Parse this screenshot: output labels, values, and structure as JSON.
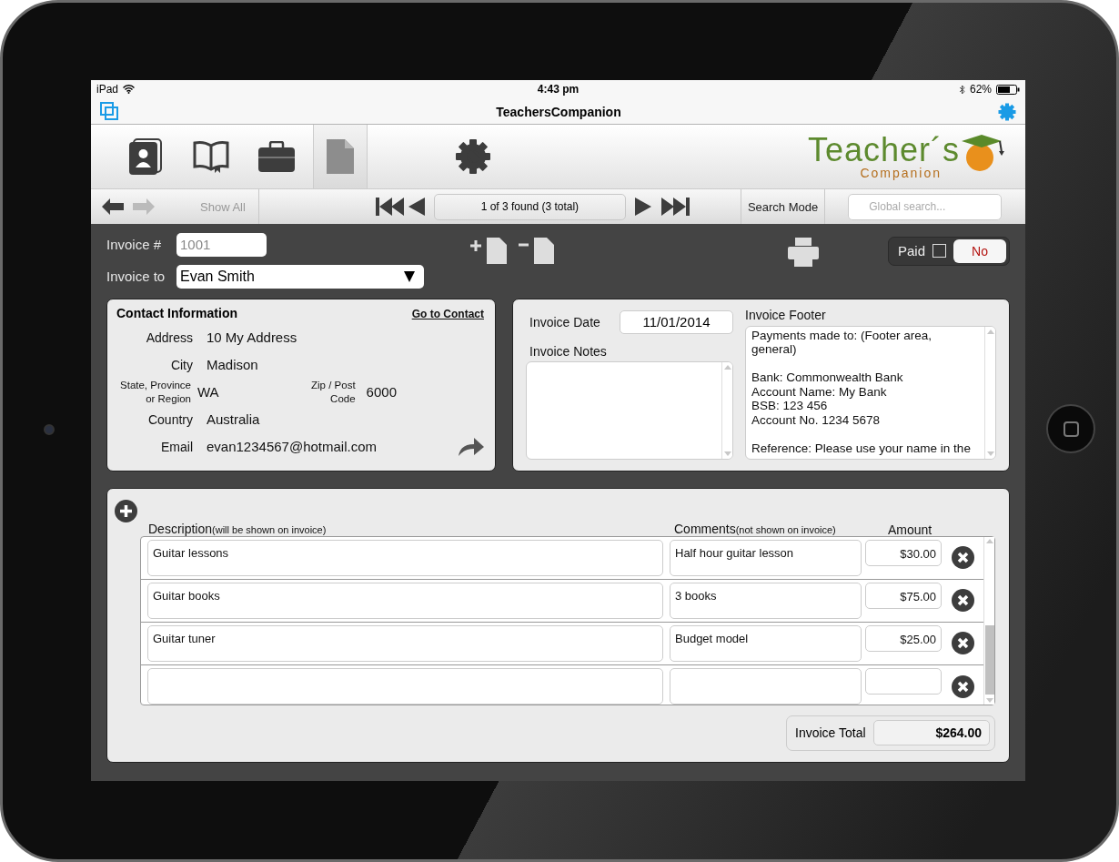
{
  "status_bar": {
    "device": "iPad",
    "time": "4:43 pm",
    "battery": "62%"
  },
  "nav_bar": {
    "title": "TeachersCompanion"
  },
  "toolbar_tabs": [
    {
      "kind": "contacts",
      "selected": false
    },
    {
      "kind": "book",
      "selected": false
    },
    {
      "kind": "briefcase",
      "selected": false
    },
    {
      "kind": "document",
      "selected": true
    },
    {
      "kind": "settings",
      "selected": false
    }
  ],
  "logo": {
    "title": "Teacher´s",
    "subtitle": "Companion"
  },
  "record_nav": {
    "back_disabled": false,
    "forward_disabled": true,
    "show_all": {
      "label": "Show All",
      "disabled": true
    },
    "found": "1 of 3 found (3 total)",
    "search_mode": "Search Mode",
    "search_placeholder": "Global search..."
  },
  "invoice": {
    "number_label": "Invoice #",
    "number": "1001",
    "to_label": "Invoice to",
    "to": "Evan Smith",
    "paid_label": "Paid",
    "paid": false,
    "paid_value": "No"
  },
  "contact": {
    "title": "Contact Information",
    "link": "Go to Contact",
    "rows": [
      {
        "label": "Address",
        "value": "10 My Address"
      },
      {
        "label": "City",
        "value": "Madison"
      },
      {
        "label": "State, Province\nor Region",
        "value": "WA",
        "zip_label": "Zip / Post\nCode",
        "zip_value": "6000"
      },
      {
        "label": "Country",
        "value": "Australia"
      },
      {
        "label": "Email",
        "value": "evan1234567@hotmail.com"
      }
    ]
  },
  "details": {
    "date_label": "Invoice Date",
    "date": "11/01/2014",
    "notes_label": "Invoice Notes",
    "footer_label": "Invoice Footer",
    "footer": "Payments made to: (Footer area,\ngeneral)\n\nBank: Commonwealth Bank\nAccount Name: My Bank\nBSB: 123 456\nAccount No. 1234 5678\n\nReference: Please use your name in the"
  },
  "items": {
    "columns": [
      {
        "title": "Description",
        "note": "(will be shown on invoice)"
      },
      {
        "title": "Comments",
        "note": "(not shown on invoice)"
      },
      {
        "title": "Amount"
      }
    ],
    "rows": [
      {
        "description": "Guitar lessons",
        "comment": "Half hour guitar lesson",
        "amount": "$30.00"
      },
      {
        "description": "Guitar books",
        "comment": "3 books",
        "amount": "$75.00"
      },
      {
        "description": "Guitar tuner",
        "comment": "Budget model",
        "amount": "$25.00"
      },
      {}
    ],
    "total_label": "Invoice Total",
    "total": "$264.00"
  }
}
